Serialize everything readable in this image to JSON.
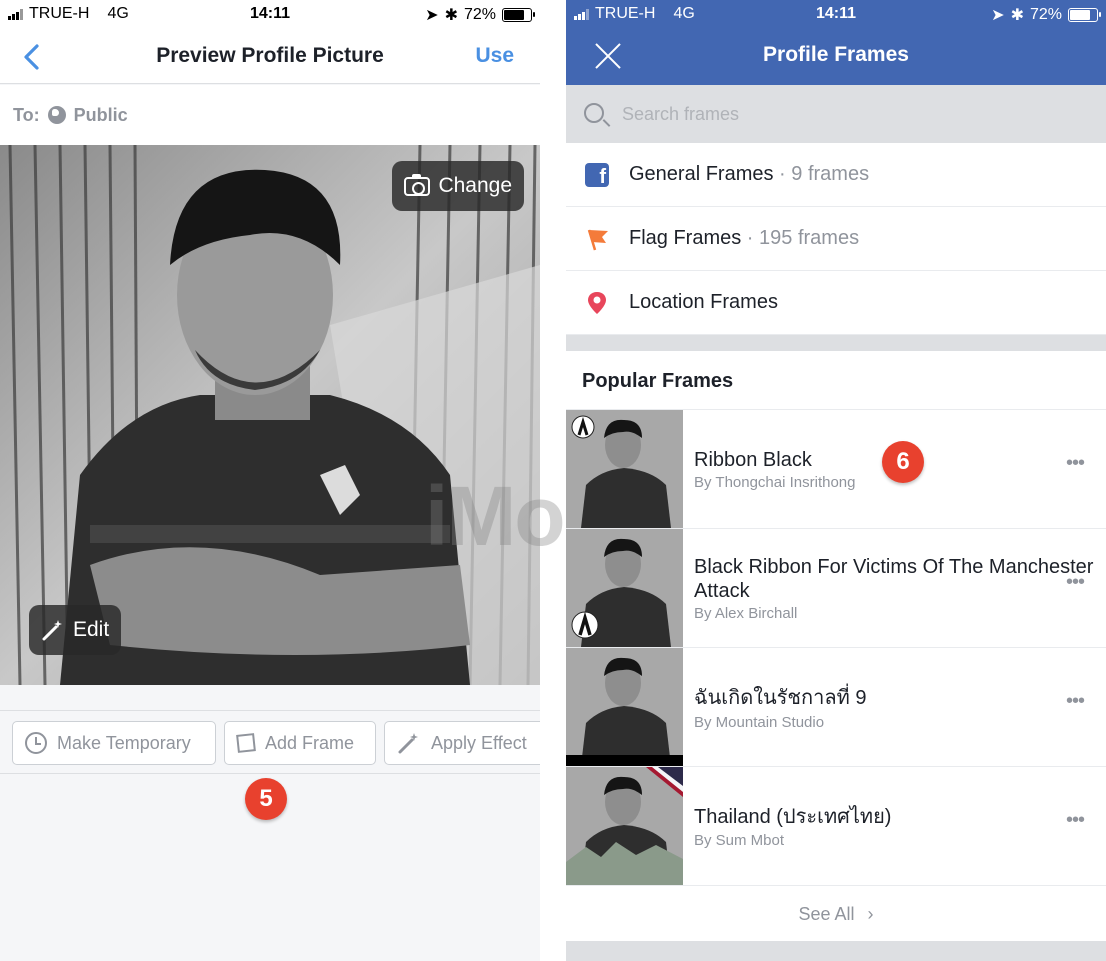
{
  "left_screen": {
    "status": {
      "carrier": "TRUE-H",
      "network": "4G",
      "time": "14:11",
      "battery": "72%",
      "battery_level": 0.72
    },
    "nav": {
      "title": "Preview Profile Picture",
      "use_label": "Use"
    },
    "audience": {
      "to_label": "To:",
      "value": "Public"
    },
    "photo": {
      "change_label": "Change",
      "edit_label": "Edit"
    },
    "actions": {
      "make_temporary": "Make Temporary",
      "add_frame": "Add Frame",
      "apply_effect": "Apply Effect"
    },
    "step_badge": "5"
  },
  "right_screen": {
    "status": {
      "carrier": "TRUE-H",
      "network": "4G",
      "time": "14:11",
      "battery": "72%",
      "battery_level": 0.72
    },
    "nav": {
      "title": "Profile Frames"
    },
    "search": {
      "placeholder": "Search frames"
    },
    "categories": [
      {
        "label": "General Frames",
        "count": " · 9 frames",
        "icon": "facebook-icon"
      },
      {
        "label": "Flag Frames",
        "count": " · 195 frames",
        "icon": "flag-icon"
      },
      {
        "label": "Location Frames",
        "count": "",
        "icon": "location-pin-icon"
      }
    ],
    "section_title": "Popular Frames",
    "frames": [
      {
        "name": "Ribbon Black",
        "author": "By Thongchai Insrithong"
      },
      {
        "name": " Black Ribbon For Victims Of The Manchester Attack",
        "author": "By Alex Birchall"
      },
      {
        "name": "ฉันเกิดในรัชกาลที่ 9",
        "author": "By Mountain Studio"
      },
      {
        "name": "Thailand (ประเทศไทย)",
        "author": "By Sum Mbot"
      }
    ],
    "see_all": "See All",
    "step_badge": "6"
  },
  "colors": {
    "facebook_blue": "#4267b2",
    "ios_link_blue": "#4a90e2",
    "badge_red": "#e8412e",
    "gray_text": "#90949c"
  },
  "watermark": "iMo"
}
